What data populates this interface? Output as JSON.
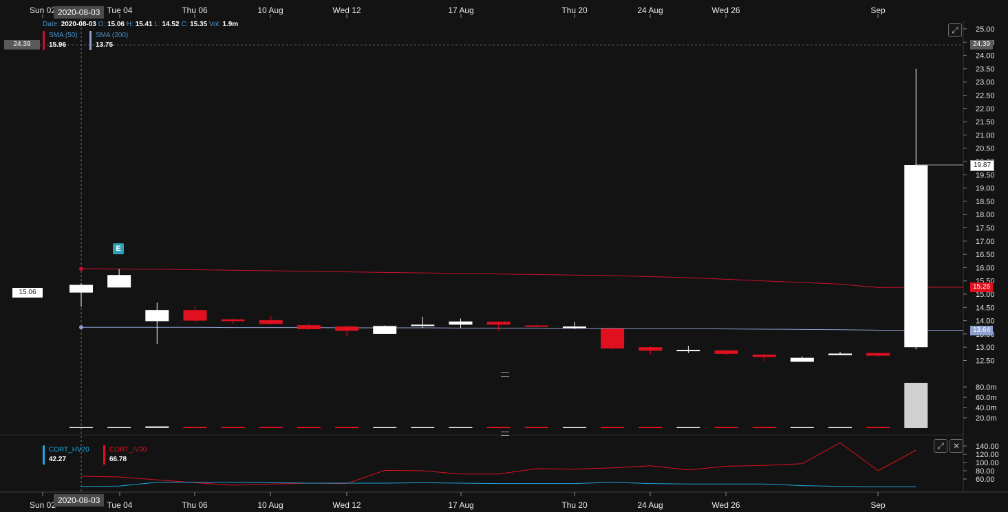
{
  "header": {
    "date_label": "Date:",
    "date": "2020-08-03",
    "o_label": "O:",
    "o": "15.06",
    "h_label": "H:",
    "h": "15.41",
    "l_label": "L:",
    "l": "14.52",
    "c_label": "C:",
    "c": "15.35",
    "vol_label": "Vol:",
    "vol": "1.9m"
  },
  "legend": {
    "sma50": {
      "name": "SMA (50)",
      "value": "15.96",
      "color": "#c8102e"
    },
    "sma200": {
      "name": "SMA (200)",
      "value": "13.75",
      "color": "#8ea0d0"
    }
  },
  "crosshair": {
    "price": "24.39",
    "date": "2020-08-03",
    "left_price": "15.06"
  },
  "price_tags": {
    "last_close": "19.87",
    "sma50": "15.26",
    "sma200": "13.64"
  },
  "lower_legend": {
    "hv": {
      "name": "CORT_HV20",
      "value": "42.27",
      "color": "#1ea7e0"
    },
    "iv": {
      "name": "CORT_IV30",
      "value": "66.78",
      "color": "#e0101e"
    }
  },
  "earnings_marker": "E",
  "icons": {
    "expand": "expand-icon",
    "close": "close-icon",
    "resize": "resize-handle-icon"
  },
  "colors": {
    "up": "#ffffff",
    "down": "#e0101e",
    "bg": "#131313"
  },
  "chart_data": {
    "type": "candlestick",
    "x_tick_labels": [
      "Sun 02",
      "Tue 04",
      "Thu 06",
      "10 Aug",
      "Wed 12",
      "17 Aug",
      "Thu 20",
      "24 Aug",
      "Wed 26",
      "Sep"
    ],
    "y_tick_labels": [
      "25.00",
      "24.50",
      "24.00",
      "23.50",
      "23.00",
      "22.50",
      "22.00",
      "21.50",
      "21.00",
      "20.50",
      "20.00",
      "19.50",
      "19.00",
      "18.50",
      "18.00",
      "17.50",
      "17.00",
      "16.50",
      "16.00",
      "15.50",
      "15.00",
      "14.50",
      "14.00",
      "13.50",
      "13.00",
      "12.50"
    ],
    "candles": [
      {
        "date": "2020-08-03",
        "o": 15.06,
        "h": 15.41,
        "l": 14.52,
        "c": 15.35
      },
      {
        "date": "2020-08-04",
        "o": 15.25,
        "h": 15.95,
        "l": 15.25,
        "c": 15.72
      },
      {
        "date": "2020-08-05",
        "o": 13.98,
        "h": 14.68,
        "l": 13.12,
        "c": 14.4
      },
      {
        "date": "2020-08-06",
        "o": 14.4,
        "h": 14.58,
        "l": 13.95,
        "c": 14.0
      },
      {
        "date": "2020-08-07",
        "o": 14.05,
        "h": 14.08,
        "l": 13.88,
        "c": 13.98
      },
      {
        "date": "2020-08-10",
        "o": 14.02,
        "h": 14.18,
        "l": 13.85,
        "c": 13.88
      },
      {
        "date": "2020-08-11",
        "o": 13.83,
        "h": 13.88,
        "l": 13.65,
        "c": 13.68
      },
      {
        "date": "2020-08-12",
        "o": 13.78,
        "h": 13.82,
        "l": 13.4,
        "c": 13.62
      },
      {
        "date": "2020-08-13",
        "o": 13.5,
        "h": 13.82,
        "l": 13.5,
        "c": 13.8
      },
      {
        "date": "2020-08-14",
        "o": 13.8,
        "h": 14.15,
        "l": 13.72,
        "c": 13.85
      },
      {
        "date": "2020-08-17",
        "o": 13.85,
        "h": 14.08,
        "l": 13.72,
        "c": 13.97
      },
      {
        "date": "2020-08-18",
        "o": 13.96,
        "h": 13.98,
        "l": 13.62,
        "c": 13.85
      },
      {
        "date": "2020-08-19",
        "o": 13.82,
        "h": 13.85,
        "l": 13.78,
        "c": 13.78
      },
      {
        "date": "2020-08-20",
        "o": 13.72,
        "h": 13.95,
        "l": 13.68,
        "c": 13.78
      },
      {
        "date": "2020-08-21",
        "o": 13.7,
        "h": 13.75,
        "l": 12.92,
        "c": 12.95
      },
      {
        "date": "2020-08-24",
        "o": 13.0,
        "h": 13.02,
        "l": 12.72,
        "c": 12.87
      },
      {
        "date": "2020-08-25",
        "o": 12.85,
        "h": 13.05,
        "l": 12.78,
        "c": 12.9
      },
      {
        "date": "2020-08-26",
        "o": 12.88,
        "h": 12.88,
        "l": 12.7,
        "c": 12.75
      },
      {
        "date": "2020-08-27",
        "o": 12.72,
        "h": 12.75,
        "l": 12.48,
        "c": 12.63
      },
      {
        "date": "2020-08-28",
        "o": 12.45,
        "h": 12.65,
        "l": 12.45,
        "c": 12.6
      },
      {
        "date": "2020-08-31",
        "o": 12.7,
        "h": 12.82,
        "l": 12.7,
        "c": 12.76
      },
      {
        "date": "2020-09-01",
        "o": 12.78,
        "h": 12.78,
        "l": 12.63,
        "c": 12.68
      },
      {
        "date": "2020-09-02",
        "o": 13.0,
        "h": 23.5,
        "l": 12.92,
        "c": 19.87
      }
    ],
    "sma50": [
      15.96,
      15.95,
      15.94,
      15.92,
      15.9,
      15.88,
      15.86,
      15.84,
      15.82,
      15.8,
      15.78,
      15.76,
      15.74,
      15.72,
      15.7,
      15.66,
      15.62,
      15.56,
      15.5,
      15.44,
      15.38,
      15.25,
      15.26
    ],
    "sma200": [
      13.75,
      13.75,
      13.75,
      13.75,
      13.74,
      13.74,
      13.74,
      13.73,
      13.73,
      13.73,
      13.72,
      13.72,
      13.72,
      13.71,
      13.71,
      13.7,
      13.7,
      13.69,
      13.68,
      13.67,
      13.66,
      13.64,
      13.64
    ],
    "volume_ticks": [
      "80.0m",
      "60.0m",
      "40.0m",
      "20.0m"
    ],
    "volume_m": [
      1.9,
      1.5,
      3.5,
      0.6,
      0.6,
      0.6,
      0.6,
      0.4,
      0.6,
      0.6,
      0.6,
      0.6,
      0.6,
      0.6,
      1.0,
      0.6,
      0.6,
      0.6,
      0.6,
      0.6,
      0.6,
      0.6,
      88.0
    ],
    "lower_y_ticks": [
      "140.00",
      "120.00",
      "100.00",
      "80.00",
      "60.00"
    ],
    "hv20": [
      42,
      43,
      52,
      52,
      52,
      51,
      50,
      50,
      50,
      51,
      50,
      49,
      49,
      49,
      52,
      49,
      48,
      48,
      48,
      44,
      42,
      41,
      41
    ],
    "iv30": [
      66.78,
      65,
      58,
      51,
      45,
      48,
      50,
      49,
      81,
      80,
      72,
      72,
      85,
      84,
      87,
      92,
      82,
      91,
      93,
      97,
      148,
      80,
      130
    ],
    "ylim": [
      12.3,
      25.2
    ]
  }
}
